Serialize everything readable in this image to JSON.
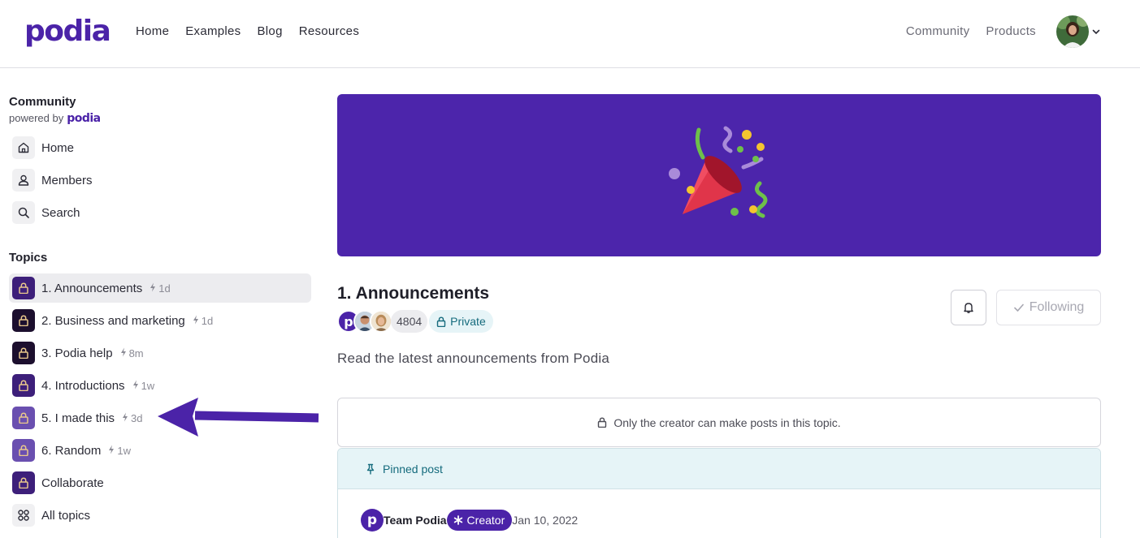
{
  "header": {
    "logo": "podia",
    "nav": [
      "Home",
      "Examples",
      "Blog",
      "Resources"
    ],
    "right_nav": [
      "Community",
      "Products"
    ]
  },
  "sidebar": {
    "title": "Community",
    "powered_by": "powered by",
    "powered_logo": "podia",
    "nav_items": [
      {
        "label": "Home",
        "icon": "home-icon"
      },
      {
        "label": "Members",
        "icon": "user-icon"
      },
      {
        "label": "Search",
        "icon": "search-icon"
      }
    ],
    "topics_title": "Topics",
    "topics": [
      {
        "label": "1. Announcements",
        "meta": "1d",
        "color": "#3d1f7a"
      },
      {
        "label": "2. Business and marketing",
        "meta": "1d",
        "color": "#1c0f2e"
      },
      {
        "label": "3. Podia help",
        "meta": "8m",
        "color": "#1c0f2e"
      },
      {
        "label": "4. Introductions",
        "meta": "1w",
        "color": "#3d1f7a"
      },
      {
        "label": "5. I made this",
        "meta": "3d",
        "color": "#6a4fb0"
      },
      {
        "label": "6. Random",
        "meta": "1w",
        "color": "#6a4fb0"
      },
      {
        "label": "Collaborate",
        "meta": "",
        "color": "#3d1f7a"
      },
      {
        "label": "All topics",
        "meta": "",
        "color": ""
      }
    ]
  },
  "topic": {
    "title": "1. Announcements",
    "member_count": "4804",
    "privacy": "Private",
    "follow_label": "Following",
    "description": "Read the latest announcements from Podia",
    "notice": "Only the creator can make posts in this topic.",
    "pinned_label": "Pinned post",
    "post": {
      "author": "Team Podia",
      "badge": "Creator",
      "date": "Jan 10, 2022"
    }
  },
  "colors": {
    "brand": "#4b23a8",
    "banner": "#4c25ab",
    "teal": "#156b7d"
  }
}
